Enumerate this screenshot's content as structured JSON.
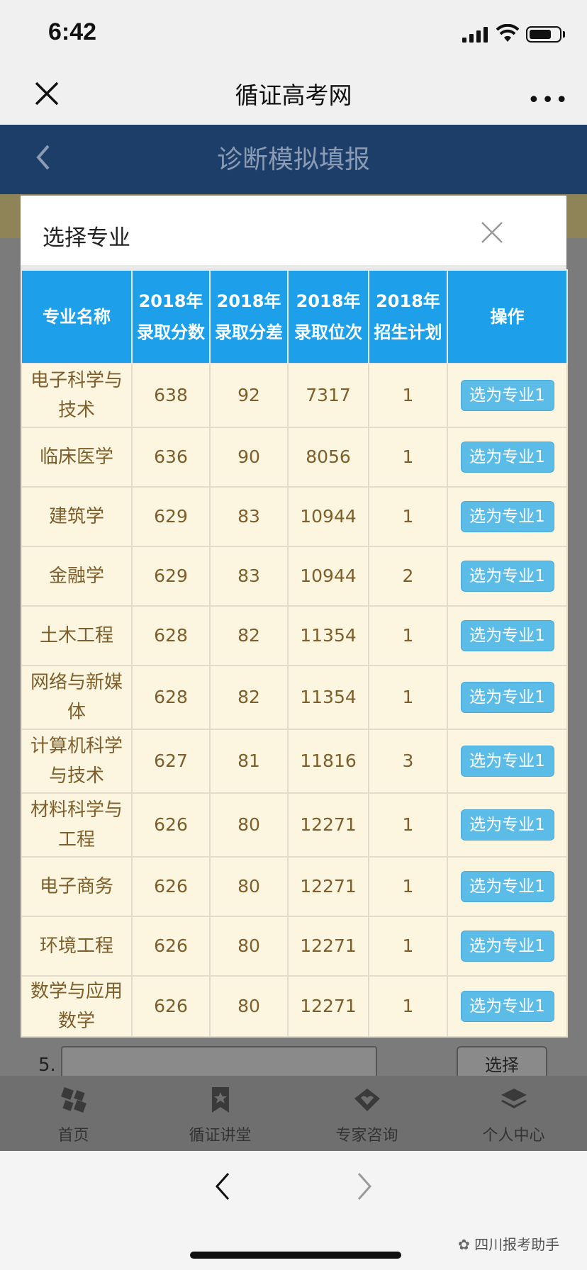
{
  "status_bar": {
    "time": "6:42"
  },
  "wechat_bar": {
    "title": "循证高考网",
    "more": "•••"
  },
  "page_header": {
    "title": "诊断模拟填报"
  },
  "background_form": {
    "row_number": "5.",
    "select_button": "选择"
  },
  "tab_bar": [
    {
      "label": "首页",
      "icon": "home-icon"
    },
    {
      "label": "循证讲堂",
      "icon": "bookmark-icon"
    },
    {
      "label": "专家咨询",
      "icon": "diamond-heart-icon"
    },
    {
      "label": "个人中心",
      "icon": "layers-icon"
    }
  ],
  "bottom_bar": {
    "brand": "四川报考助手"
  },
  "modal": {
    "title": "选择专业",
    "columns": [
      "专业名称",
      "2018年录取分数",
      "2018年录取分差",
      "2018年录取位次",
      "2018年招生计划",
      "操作"
    ],
    "rows": [
      {
        "name": "电子科学与技术",
        "score": "638",
        "diff": "92",
        "rank": "7317",
        "plan": "1",
        "action": "选为专业1"
      },
      {
        "name": "临床医学",
        "score": "636",
        "diff": "90",
        "rank": "8056",
        "plan": "1",
        "action": "选为专业1"
      },
      {
        "name": "建筑学",
        "score": "629",
        "diff": "83",
        "rank": "10944",
        "plan": "1",
        "action": "选为专业1"
      },
      {
        "name": "金融学",
        "score": "629",
        "diff": "83",
        "rank": "10944",
        "plan": "2",
        "action": "选为专业1"
      },
      {
        "name": "土木工程",
        "score": "628",
        "diff": "82",
        "rank": "11354",
        "plan": "1",
        "action": "选为专业1"
      },
      {
        "name": "网络与新媒体",
        "score": "628",
        "diff": "82",
        "rank": "11354",
        "plan": "1",
        "action": "选为专业1"
      },
      {
        "name": "计算机科学与技术",
        "score": "627",
        "diff": "81",
        "rank": "11816",
        "plan": "3",
        "action": "选为专业1"
      },
      {
        "name": "材料科学与工程",
        "score": "626",
        "diff": "80",
        "rank": "12271",
        "plan": "1",
        "action": "选为专业1"
      },
      {
        "name": "电子商务",
        "score": "626",
        "diff": "80",
        "rank": "12271",
        "plan": "1",
        "action": "选为专业1"
      },
      {
        "name": "环境工程",
        "score": "626",
        "diff": "80",
        "rank": "12271",
        "plan": "1",
        "action": "选为专业1"
      },
      {
        "name": "数学与应用数学",
        "score": "626",
        "diff": "80",
        "rank": "12271",
        "plan": "1",
        "action": "选为专业1"
      }
    ]
  },
  "colors": {
    "header_blue": "#1da0e9",
    "button_blue": "#5bbce8",
    "cell_bg": "#fcf6e1",
    "navy": "#1e3e6a"
  }
}
